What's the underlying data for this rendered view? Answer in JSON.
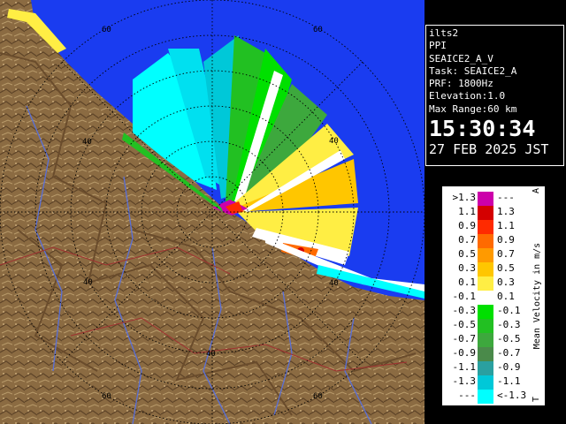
{
  "info": {
    "site": "ilts2",
    "mode": "PPI",
    "product": "SEAICE2_A_V",
    "task": "Task: SEAICE2_A",
    "prf": "PRF: 1800Hz",
    "elevation": "Elevation:1.0",
    "max_range": "Max Range:60 km",
    "time": "15:30:34",
    "date": "27 FEB 2025 JST"
  },
  "range_labels": [
    "60",
    "40",
    "40",
    "40",
    "40",
    "40",
    "60",
    "60"
  ],
  "legend": {
    "unit_label": "Mean Velocity in m/s",
    "top_marker": "A",
    "bottom_marker": "T",
    "rows": [
      {
        "lo": ">1.3",
        "hi": "---",
        "color": "#cc00aa"
      },
      {
        "lo": "1.1",
        "hi": "1.3",
        "color": "#d40000"
      },
      {
        "lo": "0.9",
        "hi": "1.1",
        "color": "#ff2a00"
      },
      {
        "lo": "0.7",
        "hi": "0.9",
        "color": "#ff6a00"
      },
      {
        "lo": "0.5",
        "hi": "0.7",
        "color": "#ff9a00"
      },
      {
        "lo": "0.3",
        "hi": "0.5",
        "color": "#ffc600"
      },
      {
        "lo": "0.1",
        "hi": "0.3",
        "color": "#ffee44"
      },
      {
        "lo": "-0.1",
        "hi": "0.1",
        "color": "#ffffff"
      },
      {
        "lo": "-0.3",
        "hi": "-0.1",
        "color": "#00e000"
      },
      {
        "lo": "-0.5",
        "hi": "-0.3",
        "color": "#22c022"
      },
      {
        "lo": "-0.7",
        "hi": "-0.5",
        "color": "#3da83d"
      },
      {
        "lo": "-0.9",
        "hi": "-0.7",
        "color": "#4a8a4a"
      },
      {
        "lo": "-1.1",
        "hi": "-0.9",
        "color": "#2aa0a0"
      },
      {
        "lo": "-1.3",
        "hi": "-1.1",
        "color": "#00c8d8"
      },
      {
        "lo": "---",
        "hi": "<-1.3",
        "color": "#00ffff"
      }
    ]
  },
  "colors": {
    "sea": "#1a3cf0",
    "land": "#8b6b42",
    "grid": "#000000"
  }
}
